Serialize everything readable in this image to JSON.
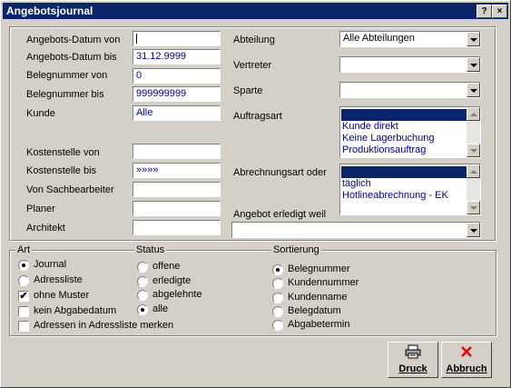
{
  "window": {
    "title": "Angebotsjournal",
    "help_btn": "?",
    "close_btn": "×"
  },
  "left_fields": [
    {
      "label": "Angebots-Datum von",
      "value": ""
    },
    {
      "label": "Angebots-Datum bis",
      "value": "31.12.9999"
    },
    {
      "label": "Belegnummer von",
      "value": "0"
    },
    {
      "label": "Belegnummer bis",
      "value": "999999999"
    },
    {
      "label": "Kunde",
      "value": "Alle"
    }
  ],
  "left_fields2": [
    {
      "label": "Kostenstelle von",
      "value": ""
    },
    {
      "label": "Kostenstelle bis",
      "value": "»»»»"
    },
    {
      "label": "Von Sachbearbeiter",
      "value": ""
    },
    {
      "label": "Planer",
      "value": ""
    },
    {
      "label": "Architekt",
      "value": ""
    }
  ],
  "right": {
    "abteilung_label": "Abteilung",
    "abteilung_value": "Alle Abteilungen",
    "vertreter_label": "Vertreter",
    "vertreter_value": "",
    "sparte_label": "Sparte",
    "sparte_value": "",
    "auftragsart_label": "Auftragsart",
    "auftragsart_items": [
      "",
      "Kunde direkt",
      "Keine Lagerbuchung",
      "Produktionsauftrag"
    ],
    "abrechnungsart_label": "Abrechnungsart oder",
    "abrechnungsart_items": [
      "",
      "täglich",
      "Hotlineabrechnung - EK"
    ],
    "erledigt_label": "Angebot erledigt weil",
    "erledigt_value": ""
  },
  "art": {
    "legend": "Art",
    "options": [
      "Journal",
      "Adressliste"
    ],
    "selected": "Journal",
    "checks": [
      {
        "label": "ohne Muster",
        "checked": true
      },
      {
        "label": "kein Abgabedatum",
        "checked": false
      },
      {
        "label": "Adressen in Adressliste merken",
        "checked": false
      }
    ]
  },
  "status": {
    "legend": "Status",
    "options": [
      "offene",
      "erledigte",
      "abgelehnte",
      "alle"
    ],
    "selected": "alle"
  },
  "sortierung": {
    "legend": "Sortierung",
    "options": [
      "Belegnummer",
      "Kundennummer",
      "Kundenname",
      "Belegdatum",
      "Abgabetermin"
    ],
    "selected": "Belegnummer"
  },
  "buttons": {
    "druck": "Druck",
    "abbruch": "Abbruch",
    "check_mark": "✔"
  }
}
